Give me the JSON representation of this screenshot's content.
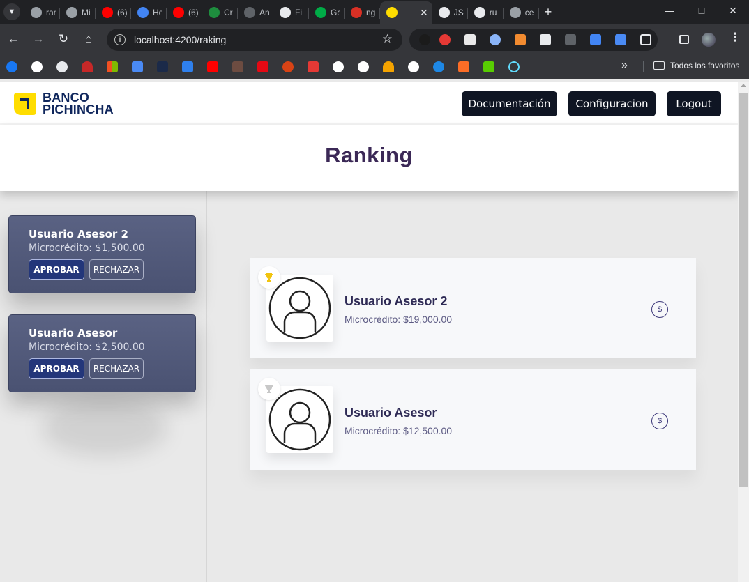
{
  "browser": {
    "tabs": [
      {
        "title": "ranking",
        "icon": "chrome-icon",
        "color": "#9aa0a6"
      },
      {
        "title": "Mi",
        "icon": "chrome-icon",
        "color": "#9aa0a6"
      },
      {
        "title": "(6)",
        "icon": "youtube-icon",
        "color": "#ff0000"
      },
      {
        "title": "Home",
        "icon": "globe-icon",
        "color": "#4285f4"
      },
      {
        "title": "(6)",
        "icon": "youtube-icon",
        "color": "#ff0000"
      },
      {
        "title": "Cr",
        "icon": "code-icon",
        "color": "#1e8e3e"
      },
      {
        "title": "An",
        "icon": "circle-icon",
        "color": "#5f6368"
      },
      {
        "title": "Fi",
        "icon": "github-icon",
        "color": "#e8eaed"
      },
      {
        "title": "Go",
        "icon": "meet-icon",
        "color": "#00ac47"
      },
      {
        "title": "ng",
        "icon": "n-icon",
        "color": "#d93025"
      },
      {
        "title": "",
        "icon": "pichincha-icon",
        "color": "#ffdd00"
      },
      {
        "title": "JS",
        "icon": "js-icon",
        "color": "#e8eaed"
      },
      {
        "title": "ru",
        "icon": "github-icon",
        "color": "#e8eaed"
      },
      {
        "title": "ce",
        "icon": "chrome-icon",
        "color": "#9aa0a6"
      }
    ],
    "active_tab_index": 10,
    "url": "localhost:4200/raking",
    "bookmarks_folder": "Todos los favoritos"
  },
  "header": {
    "logo_line1": "BANCO",
    "logo_line2": "PICHINCHA",
    "buttons": [
      "Documentación",
      "Configuracion",
      "Logout"
    ]
  },
  "page_title": "Ranking",
  "requests": [
    {
      "name": "Usuario Asesor 2",
      "amount": "Microcrédito: $1,500.00",
      "approve": "APROBAR",
      "reject": "RECHAZAR"
    },
    {
      "name": "Usuario Asesor",
      "amount": "Microcrédito: $2,500.00",
      "approve": "APROBAR",
      "reject": "RECHAZAR"
    }
  ],
  "ranking": [
    {
      "name": "Usuario Asesor 2",
      "amount": "Microcrédito: $19,000.00",
      "trophy": "gold",
      "trophy_color": "#f1c40f"
    },
    {
      "name": "Usuario Asesor",
      "amount": "Microcrédito: $12,500.00",
      "trophy": "silver",
      "trophy_color": "#c8c8c8"
    }
  ],
  "coin_symbol": "$"
}
